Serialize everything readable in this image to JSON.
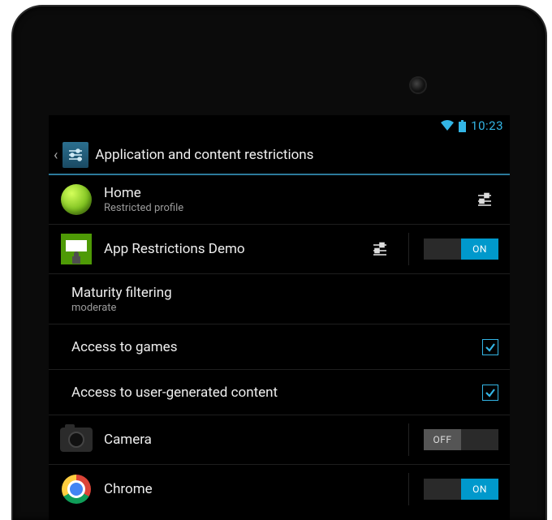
{
  "statusbar": {
    "time": "10:23"
  },
  "actionbar": {
    "title": "Application and content restrictions"
  },
  "profile": {
    "name": "Home",
    "subtitle": "Restricted profile"
  },
  "apps": {
    "restrictions_demo": {
      "name": "App Restrictions Demo",
      "switch_on_label": "ON"
    },
    "camera": {
      "name": "Camera",
      "switch_off_label": "OFF"
    },
    "chrome": {
      "name": "Chrome",
      "switch_on_label": "ON"
    }
  },
  "settings": {
    "maturity": {
      "title": "Maturity filtering",
      "value": "moderate"
    },
    "games": {
      "title": "Access to games",
      "checked": true
    },
    "ugc": {
      "title": "Access to user-generated content",
      "checked": true
    }
  }
}
